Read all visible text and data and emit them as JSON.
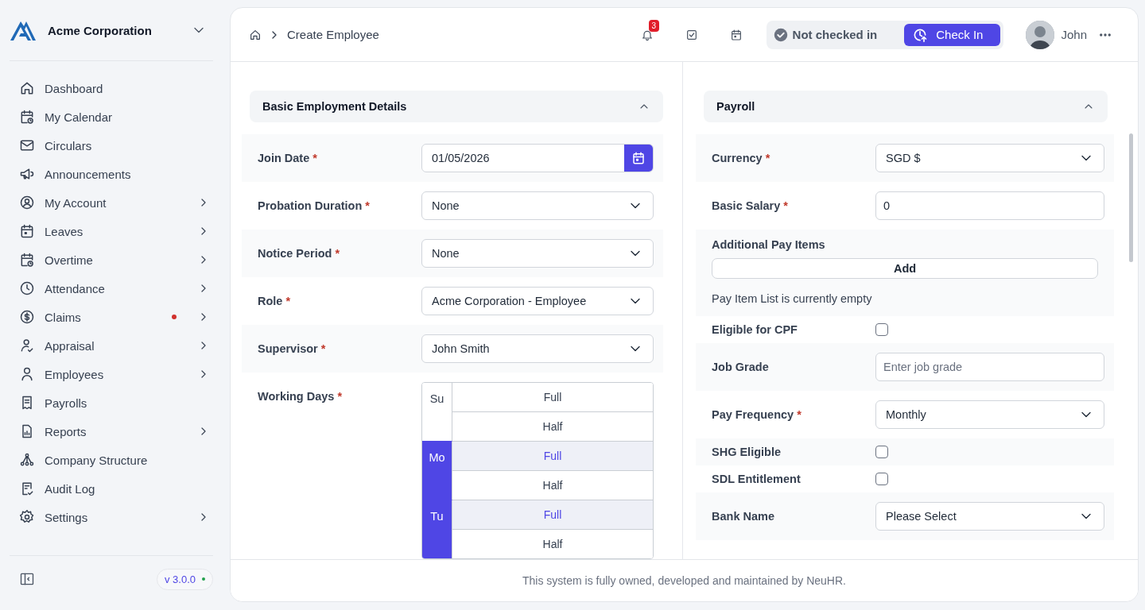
{
  "sidebar": {
    "company": "Acme Corporation",
    "items": [
      {
        "label": "Dashboard",
        "submenu": false,
        "alert": false
      },
      {
        "label": "My Calendar",
        "submenu": false,
        "alert": false
      },
      {
        "label": "Circulars",
        "submenu": false,
        "alert": false
      },
      {
        "label": "Announcements",
        "submenu": false,
        "alert": false
      },
      {
        "label": "My Account",
        "submenu": true,
        "alert": false
      },
      {
        "label": "Leaves",
        "submenu": true,
        "alert": false
      },
      {
        "label": "Overtime",
        "submenu": true,
        "alert": false
      },
      {
        "label": "Attendance",
        "submenu": true,
        "alert": false
      },
      {
        "label": "Claims",
        "submenu": true,
        "alert": true
      },
      {
        "label": "Appraisal",
        "submenu": true,
        "alert": false
      },
      {
        "label": "Employees",
        "submenu": true,
        "alert": false
      },
      {
        "label": "Payrolls",
        "submenu": false,
        "alert": false
      },
      {
        "label": "Reports",
        "submenu": true,
        "alert": false
      },
      {
        "label": "Company Structure",
        "submenu": false,
        "alert": false
      },
      {
        "label": "Audit Log",
        "submenu": false,
        "alert": false
      },
      {
        "label": "Settings",
        "submenu": true,
        "alert": false
      }
    ],
    "version": "v 3.0.0"
  },
  "header": {
    "breadcrumb": "Create Employee",
    "notification_count": "3",
    "status": "Not checked in",
    "check_in": "Check In",
    "user": "John"
  },
  "sections": [
    {
      "title": "Basic Employment Details",
      "expanded": true,
      "fields": [
        {
          "kind": "date",
          "label": "Join Date",
          "required_mark": "*",
          "value": "01/05/2026"
        },
        {
          "kind": "select",
          "label": "Probation Duration",
          "required_mark": "*",
          "value": "None"
        },
        {
          "kind": "select",
          "label": "Notice Period",
          "required_mark": "*",
          "value": "None"
        },
        {
          "kind": "select",
          "label": "Role",
          "required_mark": "*",
          "value": "Acme Corporation - Employee"
        },
        {
          "kind": "select",
          "label": "Supervisor",
          "required_mark": "*",
          "value": "John Smith"
        },
        {
          "kind": "working_days",
          "label": "Working Days",
          "required_mark": "*",
          "days": [
            {
              "day": "Su",
              "selected": false,
              "options": [
                {
                  "label": "Full",
                  "selected": false
                },
                {
                  "label": "Half",
                  "selected": false
                }
              ]
            },
            {
              "day": "Mo",
              "selected": true,
              "options": [
                {
                  "label": "Full",
                  "selected": true
                },
                {
                  "label": "Half",
                  "selected": false
                }
              ]
            },
            {
              "day": "Tu",
              "selected": true,
              "options": [
                {
                  "label": "Full",
                  "selected": true
                },
                {
                  "label": "Half",
                  "selected": false
                }
              ]
            }
          ]
        }
      ]
    },
    {
      "title": "Payroll",
      "expanded": true,
      "fields": [
        {
          "kind": "select",
          "label": "Currency",
          "required_mark": "*",
          "value": "SGD $"
        },
        {
          "kind": "input",
          "label": "Basic Salary",
          "required_mark": "*",
          "value": "0"
        },
        {
          "kind": "pay_items",
          "label": "Additional Pay Items",
          "button": "Add",
          "empty_text": "Pay Item List is currently empty"
        },
        {
          "kind": "checkbox",
          "label": "Eligible for CPF",
          "checked": false
        },
        {
          "kind": "input",
          "label": "Job Grade",
          "placeholder": "Enter job grade"
        },
        {
          "kind": "select",
          "label": "Pay Frequency",
          "required_mark": "*",
          "value": "Monthly"
        },
        {
          "kind": "checkbox",
          "label": "SHG Eligible",
          "checked": false
        },
        {
          "kind": "checkbox",
          "label": "SDL Entitlement",
          "checked": false
        },
        {
          "kind": "select",
          "label": "Bank Name",
          "value": "Please Select"
        }
      ]
    }
  ],
  "footer": "This system is fully owned, developed and maintained by NeuHR."
}
